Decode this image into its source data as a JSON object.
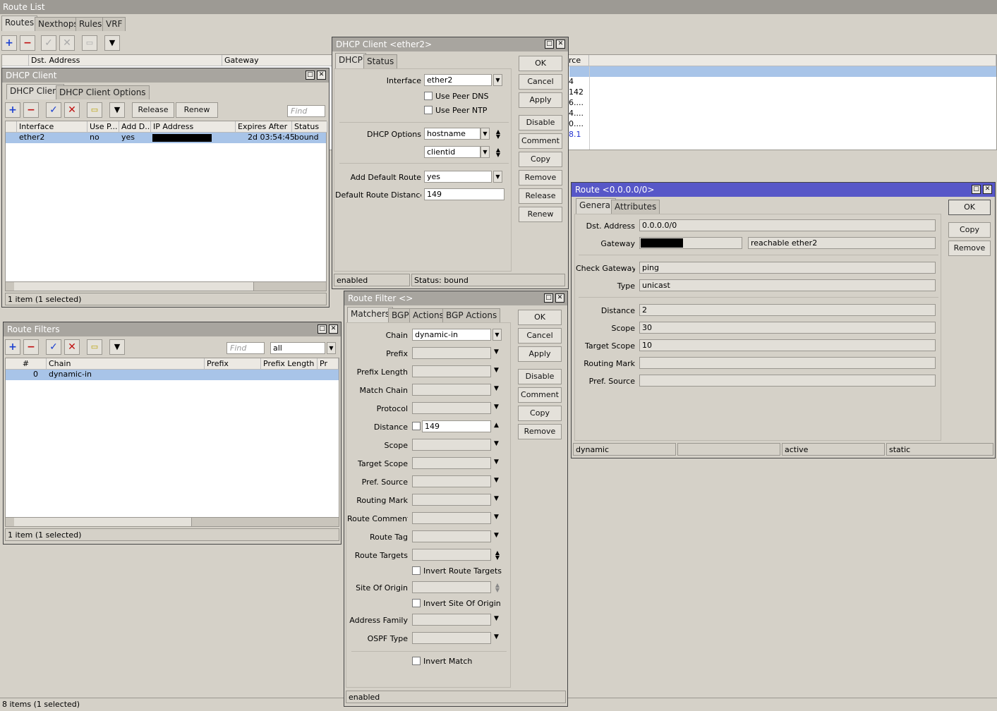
{
  "main": {
    "title": "Route List",
    "tabs": [
      "Routes",
      "Nexthops",
      "Rules",
      "VRF"
    ],
    "columns": {
      "dst": "Dst. Address",
      "gateway": "Gateway",
      "source": "rce"
    },
    "partial_rows": [
      "",
      "4",
      "142",
      "6....",
      "4....",
      "0....",
      "8.1"
    ],
    "status": "8 items (1 selected)"
  },
  "dhcp_list": {
    "title": "DHCP Client",
    "tabs": [
      "DHCP Client",
      "DHCP Client Options"
    ],
    "release": "Release",
    "renew": "Renew",
    "find": "Find",
    "columns": [
      "Interface",
      "Use P...",
      "Add D...",
      "IP Address",
      "Expires After",
      "Status"
    ],
    "row": {
      "interface": "ether2",
      "use_peer": "no",
      "add_default": "yes",
      "expires": "2d 03:54:45",
      "status": "bound"
    },
    "status": "1 item (1 selected)"
  },
  "route_filters": {
    "title": "Route Filters",
    "find": "Find",
    "filter_value": "all",
    "columns": [
      "#",
      "Chain",
      "Prefix",
      "Prefix Length",
      "Pr"
    ],
    "row": {
      "num": "0",
      "chain": "dynamic-in"
    },
    "status": "1 item (1 selected)"
  },
  "dhcp_dialog": {
    "title": "DHCP Client <ether2>",
    "tabs": [
      "DHCP",
      "Status"
    ],
    "interface_label": "Interface",
    "interface_value": "ether2",
    "use_peer_dns": "Use Peer DNS",
    "use_peer_ntp": "Use Peer NTP",
    "dhcp_options_label": "DHCP Options",
    "option1": "hostname",
    "option2": "clientid",
    "add_default_label": "Add Default Route",
    "add_default_value": "yes",
    "distance_label": "Default Route Distance",
    "distance_value": "149",
    "buttons": [
      "OK",
      "Cancel",
      "Apply",
      "Disable",
      "Comment",
      "Copy",
      "Remove",
      "Release",
      "Renew"
    ],
    "status_left": "enabled",
    "status_right": "Status: bound"
  },
  "route_filter_dialog": {
    "title": "Route Filter <>",
    "tabs": [
      "Matchers",
      "BGP",
      "Actions",
      "BGP Actions"
    ],
    "chain_label": "Chain",
    "chain_value": "dynamic-in",
    "labels": [
      "Prefix",
      "Prefix Length",
      "Match Chain",
      "Protocol"
    ],
    "distance_label": "Distance",
    "distance_value": "149",
    "labels2": [
      "Scope",
      "Target Scope",
      "Pref. Source",
      "Routing Mark",
      "Route Comment",
      "Route Tag"
    ],
    "route_targets_label": "Route Targets",
    "invert_route_targets": "Invert Route Targets",
    "site_of_origin_label": "Site Of Origin",
    "invert_site_of_origin": "Invert Site Of Origin",
    "address_family_label": "Address Family",
    "ospf_type_label": "OSPF Type",
    "invert_match": "Invert Match",
    "buttons": [
      "OK",
      "Cancel",
      "Apply",
      "Disable",
      "Comment",
      "Copy",
      "Remove"
    ],
    "status": "enabled"
  },
  "route_dialog": {
    "title": "Route <0.0.0.0/0>",
    "tabs": [
      "General",
      "Attributes"
    ],
    "dst_label": "Dst. Address",
    "dst_value": "0.0.0.0/0",
    "gateway_label": "Gateway",
    "gateway_state": "reachable ether2",
    "check_gateway_label": "Check Gateway",
    "check_gateway_value": "ping",
    "type_label": "Type",
    "type_value": "unicast",
    "distance_label": "Distance",
    "distance_value": "2",
    "scope_label": "Scope",
    "scope_value": "30",
    "target_scope_label": "Target Scope",
    "target_scope_value": "10",
    "routing_mark_label": "Routing Mark",
    "pref_source_label": "Pref. Source",
    "buttons": [
      "OK",
      "Copy",
      "Remove"
    ],
    "status": [
      "dynamic",
      "",
      "active",
      "static"
    ]
  }
}
